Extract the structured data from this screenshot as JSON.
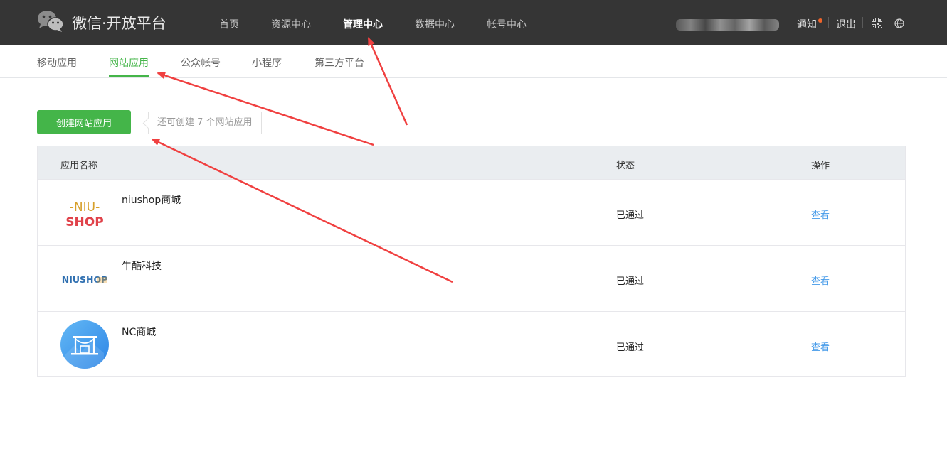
{
  "header": {
    "brand": "微信·开放平台",
    "nav": [
      {
        "label": "首页",
        "active": false
      },
      {
        "label": "资源中心",
        "active": false
      },
      {
        "label": "管理中心",
        "active": true
      },
      {
        "label": "数据中心",
        "active": false
      },
      {
        "label": "帐号中心",
        "active": false
      }
    ],
    "notice_label": "通知",
    "logout_label": "退出",
    "icons": [
      "wechat-logo",
      "notice-dot",
      "qrcode-icon",
      "globe-icon"
    ]
  },
  "subnav": {
    "tabs": [
      {
        "label": "移动应用",
        "active": false
      },
      {
        "label": "网站应用",
        "active": true
      },
      {
        "label": "公众帐号",
        "active": false
      },
      {
        "label": "小程序",
        "active": false
      },
      {
        "label": "第三方平台",
        "active": false
      }
    ]
  },
  "actions": {
    "create_label": "创建网站应用",
    "tip": "还可创建 7 个网站应用"
  },
  "table": {
    "headers": {
      "name": "应用名称",
      "status": "状态",
      "op": "操作"
    },
    "rows": [
      {
        "name": "niushop商城",
        "status": "已通过",
        "op": "查看",
        "logo_text_1": "-NIU-",
        "logo_text_2": "SHOP"
      },
      {
        "name": "牛酷科技",
        "status": "已通过",
        "op": "查看",
        "logo_text_1": "NIUSHOP"
      },
      {
        "name": "NC商城",
        "status": "已通过",
        "op": "查看"
      }
    ]
  },
  "colors": {
    "topbar": "#353535",
    "accent_green": "#44b549",
    "link_blue": "#459ae9",
    "annotation_red": "#f04040"
  }
}
